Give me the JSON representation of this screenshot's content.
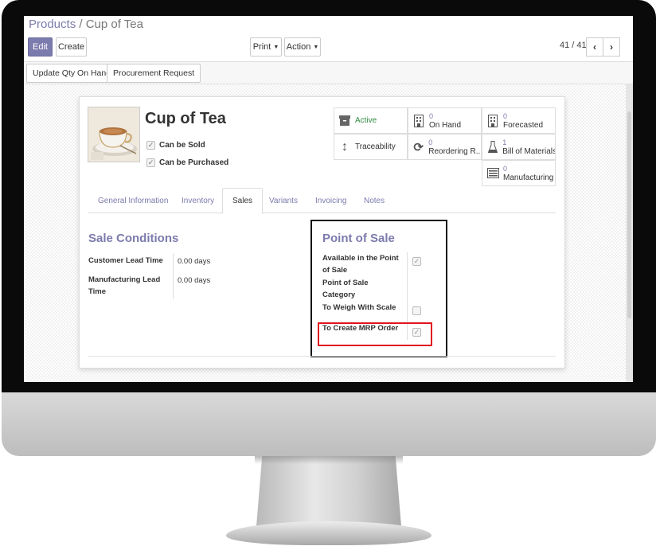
{
  "breadcrumb": {
    "parent": "Products",
    "separator": "/",
    "current": "Cup of Tea"
  },
  "toolbar": {
    "edit": "Edit",
    "create": "Create",
    "print": "Print",
    "action": "Action",
    "pager": "41 / 41"
  },
  "actions": {
    "update_qty": "Update Qty On Hand",
    "procurement": "Procurement Request"
  },
  "product": {
    "name": "Cup of Tea",
    "can_be_sold": "Can be Sold",
    "can_be_purchased": "Can be Purchased"
  },
  "smart_buttons": {
    "active": "Active",
    "on_hand_num": "0",
    "on_hand": "On Hand",
    "forecasted_num": "0",
    "forecasted": "Forecasted",
    "traceability": "Traceability",
    "reordering_num": "0",
    "reordering": "Reordering R...",
    "bom_num": "1",
    "bom": "Bill of Materials",
    "manufacturing_num": "0",
    "manufacturing": "Manufacturing"
  },
  "tabs": [
    "General Information",
    "Inventory",
    "Sales",
    "Variants",
    "Invoicing",
    "Notes"
  ],
  "active_tab": "Sales",
  "sale_conditions": {
    "title": "Sale Conditions",
    "customer_lead_label": "Customer Lead Time",
    "customer_lead_value": "0.00 days",
    "mfg_lead_label_1": "Manufacturing Lead",
    "mfg_lead_label_2": "Time",
    "mfg_lead_value": "0.00 days"
  },
  "pos": {
    "title": "Point of Sale",
    "available_1": "Available in the Point",
    "available_2": "of Sale",
    "category_1": "Point of Sale",
    "category_2": "Category",
    "weigh": "To Weigh With Scale",
    "mrp": "To Create MRP Order",
    "available_checked": true,
    "weigh_checked": false,
    "mrp_checked": true
  },
  "colors": {
    "accent": "#7c7bad",
    "highlight_red": "#e0141e",
    "active_green": "#2f8a3f"
  }
}
